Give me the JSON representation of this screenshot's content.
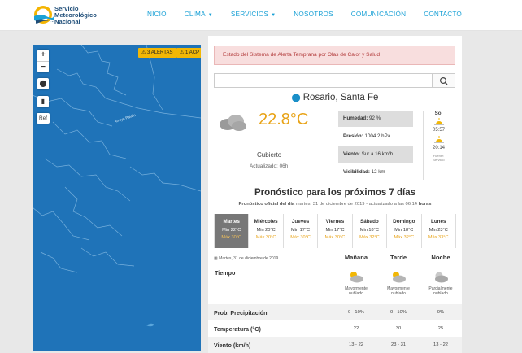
{
  "header": {
    "logo_line1": "Servicio",
    "logo_line2": "Meteorológico",
    "logo_line3": "Nacional",
    "nav": [
      {
        "label": "INICIO"
      },
      {
        "label": "CLIMA"
      },
      {
        "label": "SERVICIOS"
      },
      {
        "label": "NOSOTROS"
      },
      {
        "label": "COMUNICACIÓN"
      },
      {
        "label": "CONTACTO"
      }
    ]
  },
  "map": {
    "zoom_in": "+",
    "zoom_out": "−",
    "ref_label": "Ref",
    "alerts_label": "3 ALERTAS",
    "acp_label": "1 ACP",
    "river_label": "Arroyo Pavón",
    "colors": {
      "water": "#1f73b8",
      "alert": "#f2b705"
    }
  },
  "alert_status": "Estado del Sistema de Alerta Temprana por Olas de Calor y Salud",
  "search": {
    "placeholder": ""
  },
  "location": "Rosario, Santa Fe",
  "current": {
    "temperature": "22.8°C",
    "description": "Cubierto",
    "updated": "Actualizado: 06h",
    "humidity_label": "Humedad:",
    "humidity_value": "92 %",
    "pressure_label": "Presión:",
    "pressure_value": "1004.2 hPa",
    "wind_label": "Viento:",
    "wind_value": "Sur a 16 km/h",
    "visibility_label": "Visibilidad:",
    "visibility_value": "12 km"
  },
  "sun": {
    "title": "Sol",
    "sunrise": "05:57",
    "sunset": "20:14",
    "footer_line1": "Fuente:",
    "footer_line2": "Servicio",
    "footer_line3": "Hidrográfico",
    "footer_line4": "Naval"
  },
  "forecast": {
    "title": "Pronóstico para los próximos 7 días",
    "subtitle_prefix": "Pronóstico oficial del día",
    "subtitle_date": "martes, 31 de diciembre de 2019",
    "subtitle_mid": "- actualizado a las",
    "subtitle_time": "06:14",
    "subtitle_suffix": "horas",
    "days": [
      {
        "name": "Martes",
        "min": "Min 22°C",
        "max": "Máx 30°C"
      },
      {
        "name": "Miércoles",
        "min": "Min 20°C",
        "max": "Máx 30°C"
      },
      {
        "name": "Jueves",
        "min": "Min 17°C",
        "max": "Máx 30°C"
      },
      {
        "name": "Viernes",
        "min": "Min 17°C",
        "max": "Máx 30°C"
      },
      {
        "name": "Sábado",
        "min": "Min 18°C",
        "max": "Máx 32°C"
      },
      {
        "name": "Domingo",
        "min": "Min 18°C",
        "max": "Máx 32°C"
      },
      {
        "name": "Lunes",
        "min": "Min 23°C",
        "max": "Máx 33°C"
      }
    ],
    "detail_date": "Martes, 31 de diciembre de 2019",
    "periods": [
      {
        "name": "Mañana",
        "desc1": "Mayormente",
        "desc2": "nublado",
        "precip": "0 - 10%",
        "temp": "22",
        "wind": "13 - 22"
      },
      {
        "name": "Tarde",
        "desc1": "Mayormente",
        "desc2": "nublado",
        "precip": "0 - 10%",
        "temp": "30",
        "wind": "23 - 31"
      },
      {
        "name": "Noche",
        "desc1": "Parcialmente",
        "desc2": "nublado",
        "precip": "0%",
        "temp": "25",
        "wind": "13 - 22"
      }
    ],
    "row_tiempo": "Tiempo",
    "row_precip": "Prob. Precipitación",
    "row_temp": "Temperatura (°C)",
    "row_wind": "Viento (km/h)"
  }
}
